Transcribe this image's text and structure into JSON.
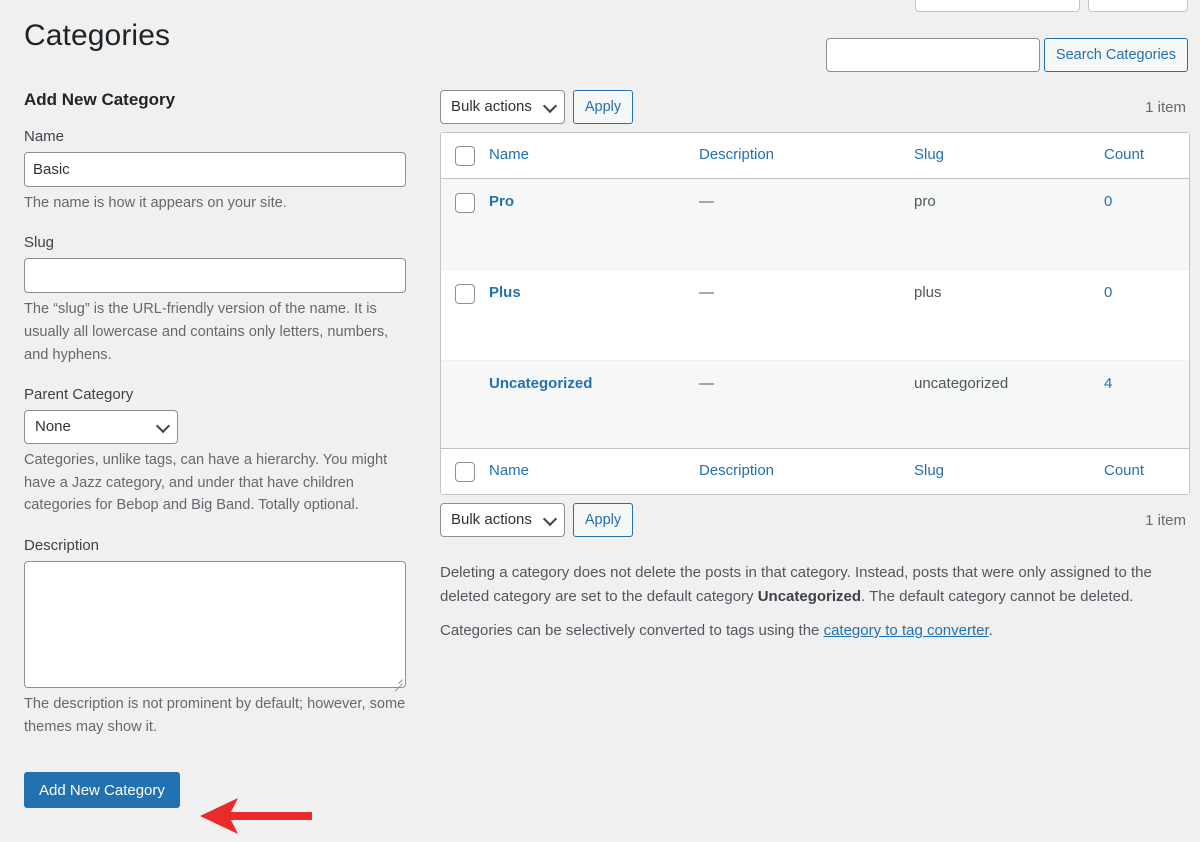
{
  "page": {
    "title": "Categories"
  },
  "screen_meta": {
    "tabs": [
      "",
      ""
    ]
  },
  "search": {
    "value": "",
    "placeholder": "",
    "button_label": "Search Categories"
  },
  "form": {
    "heading": "Add New Category",
    "name": {
      "label": "Name",
      "value": "Basic",
      "help": "The name is how it appears on your site."
    },
    "slug": {
      "label": "Slug",
      "value": "",
      "help": "The “slug” is the URL-friendly version of the name. It is usually all lowercase and contains only letters, numbers, and hyphens."
    },
    "parent": {
      "label": "Parent Category",
      "selected": "None",
      "options": [
        "None"
      ],
      "help": "Categories, unlike tags, can have a hierarchy. You might have a Jazz category, and under that have children categories for Bebop and Big Band. Totally optional."
    },
    "description": {
      "label": "Description",
      "value": "",
      "help": "The description is not prominent by default; however, some themes may show it."
    },
    "submit_label": "Add New Category"
  },
  "tablenav_top": {
    "bulk_actions_label": "Bulk actions",
    "apply_label": "Apply",
    "displaying_num": "1 item"
  },
  "tablenav_bottom": {
    "bulk_actions_label": "Bulk actions",
    "apply_label": "Apply",
    "displaying_num": "1 item"
  },
  "table": {
    "columns": {
      "name": "Name",
      "description": "Description",
      "slug": "Slug",
      "count": "Count"
    },
    "rows": [
      {
        "name": "Pro",
        "description": "—",
        "slug": "pro",
        "count": "0",
        "has_checkbox": true,
        "alt": true
      },
      {
        "name": "Plus",
        "description": "—",
        "slug": "plus",
        "count": "0",
        "has_checkbox": true,
        "alt": false
      },
      {
        "name": "Uncategorized",
        "description": "—",
        "slug": "uncategorized",
        "count": "4",
        "has_checkbox": false,
        "alt": true
      }
    ]
  },
  "notes": {
    "line1_part1": "Deleting a category does not delete the posts in that category. Instead, posts that were only assigned to the deleted category are set to the default category ",
    "line1_bold": "Uncategorized",
    "line1_part2": ". The default category cannot be deleted.",
    "line2_part1": "Categories can be selectively converted to tags using the ",
    "line2_link": "category to tag converter",
    "line2_part2": "."
  },
  "annotation": {
    "arrow_color": "#eb2a2a",
    "points_to": "Add New Category"
  },
  "colors": {
    "accent": "#2271b1",
    "page_bg": "#f0f0f1",
    "row_alt_bg": "#f6f7f7",
    "border": "#c3c4c7"
  }
}
